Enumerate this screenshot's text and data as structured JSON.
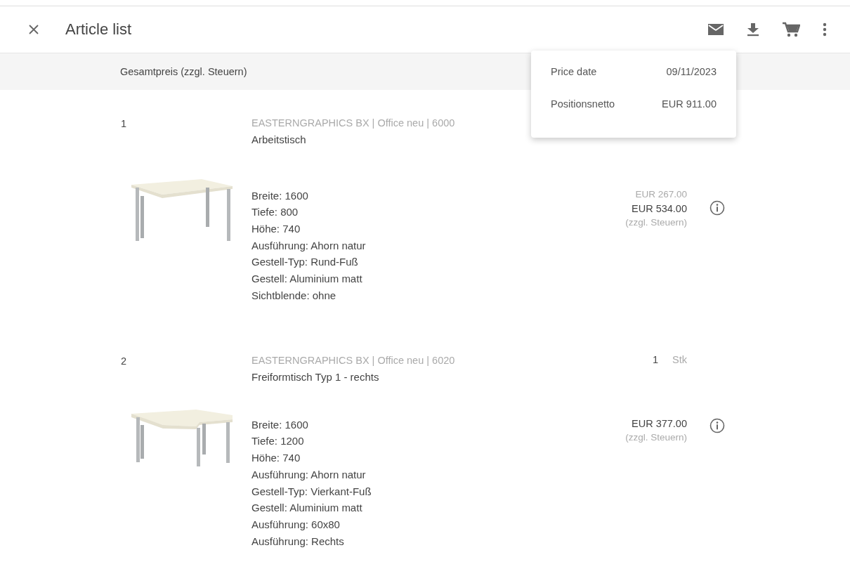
{
  "header": {
    "title": "Article list"
  },
  "summary": {
    "label": "Gesamtpreis (zzgl. Steuern)"
  },
  "popup": {
    "rows": [
      {
        "label": "Price date",
        "value": "09/11/2023"
      },
      {
        "label": "Positionsnetto",
        "value": "EUR 911.00"
      }
    ]
  },
  "articles": [
    {
      "number": "1",
      "kind": "desk",
      "source": "EASTERNGRAPHICS BX | Office neu | 6000",
      "name": "Arbeitstisch",
      "properties": [
        "Breite: 1600",
        "Tiefe: 800",
        "Höhe: 740",
        "Ausführung: Ahorn natur",
        "Gestell-Typ: Rund-Fuß",
        "Gestell: Aluminium matt",
        "Sichtblende: ohne"
      ],
      "unit_price": "EUR 267.00",
      "total": "EUR 534.00",
      "tax_note": "(zzgl. Steuern)"
    },
    {
      "number": "2",
      "kind": "corner-desk",
      "source": "EASTERNGRAPHICS BX | Office neu | 6020",
      "name": "Freiformtisch Typ 1 - rechts",
      "quantity": "1",
      "unit": "Stk",
      "properties": [
        "Breite: 1600",
        "Tiefe: 1200",
        "Höhe: 740",
        "Ausführung: Ahorn natur",
        "Gestell-Typ: Vierkant-Fuß",
        "Gestell: Aluminium matt",
        "Ausführung: 60x80",
        "Ausführung: Rechts"
      ],
      "total": "EUR 377.00",
      "tax_note": "(zzgl. Steuern)"
    }
  ]
}
